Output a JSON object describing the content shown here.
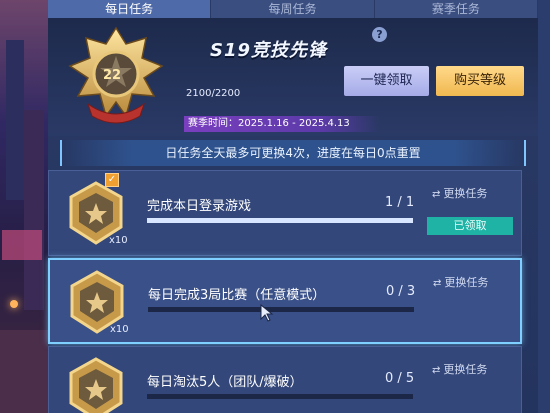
{
  "tabs": [
    {
      "label": "每日任务",
      "active": true
    },
    {
      "label": "每周任务",
      "active": false
    },
    {
      "label": "赛季任务",
      "active": false
    }
  ],
  "header": {
    "rank_level": "22",
    "season_title": "S19竞技先锋",
    "help_icon": "?",
    "xp_text": "2100/2200",
    "season_time": "赛季时间：2025.1.16 - 2025.4.13",
    "claim_all_label": "一键领取",
    "buy_level_label": "购买等级"
  },
  "notice": "日任务全天最多可更换4次，进度在每日0点重置",
  "tasks": [
    {
      "title": "完成本日登录游戏",
      "progress_text": "1 / 1",
      "progress": 1.0,
      "multiplier": "x10",
      "swap_label": "更换任务",
      "status": "已领取",
      "checked": true
    },
    {
      "title": "每日完成3局比赛（任意模式）",
      "progress_text": "0 / 3",
      "progress": 0.0,
      "multiplier": "x10",
      "swap_label": "更换任务",
      "checked": false
    },
    {
      "title": "每日淘汰5人（团队/爆破）",
      "progress_text": "0 / 5",
      "progress": 0.0,
      "multiplier": "",
      "swap_label": "更换任务",
      "checked": false
    }
  ],
  "colors": {
    "accent_teal": "#1fb3a6",
    "gold_button": "#f0b850",
    "lavender_button": "#a6abe8",
    "selected_border": "#7fd0ff"
  }
}
